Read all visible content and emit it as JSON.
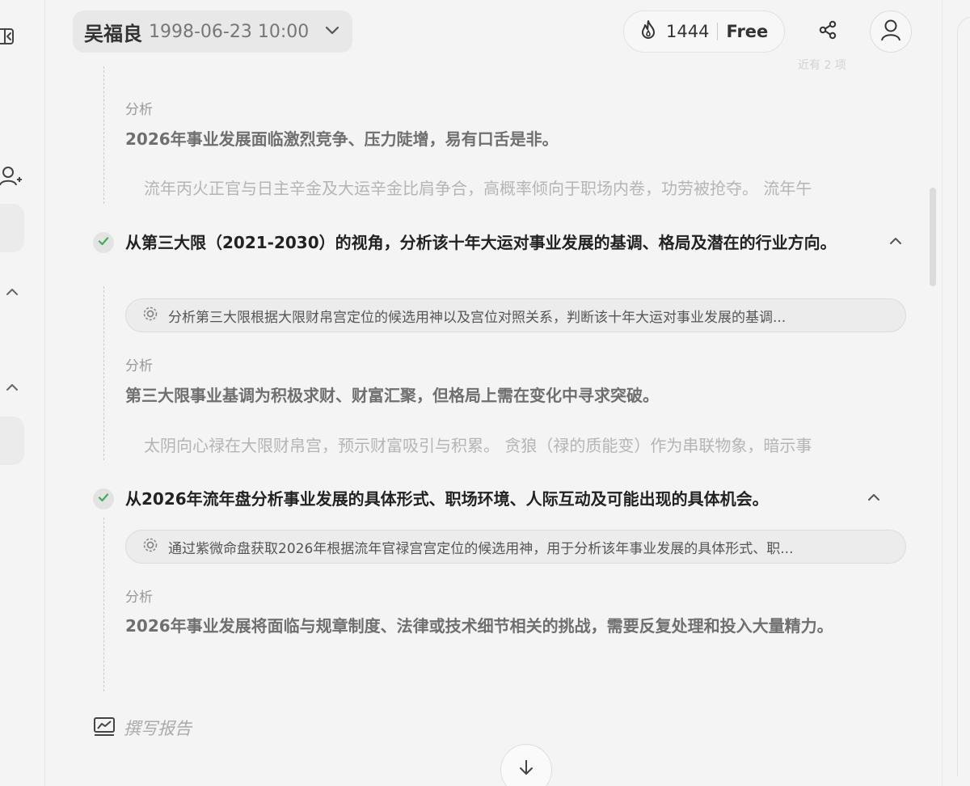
{
  "header": {
    "profile_name": "吴福良",
    "profile_datetime": "1998-06-23 10:00",
    "credits": "1444",
    "plan": "Free",
    "faded_text": "近有 2 项"
  },
  "section1": {
    "label": "分析",
    "summary": "2026年事业发展面临激烈竞争、压力陡增，易有口舌是非。",
    "detail": "流年丙火正官与日主辛金及大运辛金比肩争合，高概率倾向于职场内卷，功劳被抢夺。 流年午"
  },
  "step2": {
    "title": "从第三大限（2021-2030）的视角，分析该十年大运对事业发展的基调、格局及潜在的行业方向。",
    "tool_text": "分析第三大限根据大限财帛宫定位的候选用神以及宫位对照关系，判断该十年大运对事业发展的基调...",
    "label": "分析",
    "summary": "第三大限事业基调为积极求财、财富汇聚，但格局上需在变化中寻求突破。",
    "detail": "太阴向心禄在大限财帛宫，预示财富吸引与积累。 贪狼（禄的质能变）作为串联物象，暗示事"
  },
  "step3": {
    "title": "从2026年流年盘分析事业发展的具体形式、职场环境、人际互动及可能出现的具体机会。",
    "tool_text": "通过紫微命盘获取2026年根据流年官禄宫宫定位的候选用神，用于分析该年事业发展的具体形式、职...",
    "label": "分析",
    "summary": "2026年事业发展将面临与规章制度、法律或技术细节相关的挑战，需要反复处理和投入大量精力。"
  },
  "report": {
    "label": "撰写报告"
  },
  "icons": {
    "sidebar_collapse": "sidebar-collapse-icon",
    "add_user": "add-user-icon",
    "chevron_down": "chevron-down-icon",
    "chevron_up": "chevron-up-icon",
    "flame": "flame-icon",
    "share": "share-icon",
    "user": "user-icon",
    "check": "check-icon",
    "tool": "tool-icon",
    "report": "chart-report-icon",
    "arrow_down": "arrow-down-icon"
  },
  "colors": {
    "check": "#3fae5a",
    "background": "#f4f4f4"
  }
}
